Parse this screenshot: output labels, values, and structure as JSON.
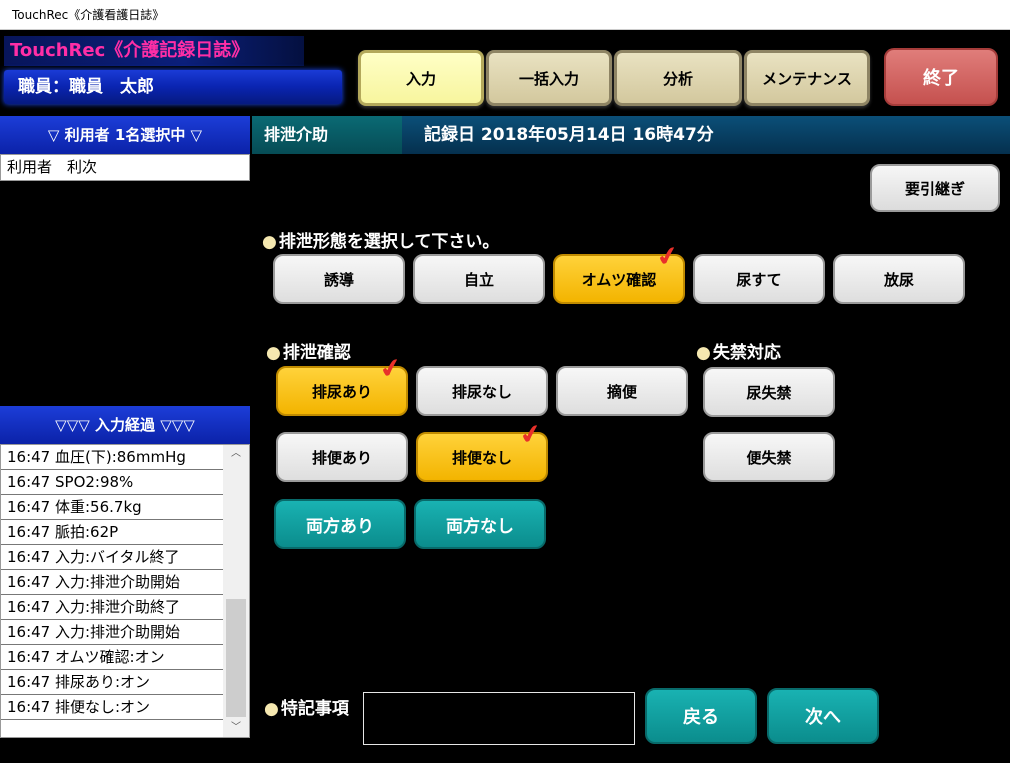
{
  "window": {
    "title": "TouchRec《介護看護日誌》"
  },
  "header": {
    "app_title": "TouchRec《介護記録日誌》",
    "staff": "職員：職員　太郎",
    "nav": [
      "入力",
      "一括入力",
      "分析",
      "メンテナンス"
    ],
    "active_nav": "入力",
    "exit_label": "終了"
  },
  "users_panel": {
    "header": "▽ 利用者 1名選択中 ▽",
    "selected_user": "利用者　利次"
  },
  "section": {
    "name": "排泄介助",
    "record_date": "記録日 2018年05月14日 16時47分"
  },
  "handover_label": "要引継ぎ",
  "excretion_type": {
    "label": "排泄形態を選択して下さい。",
    "options": [
      {
        "label": "誘導",
        "selected": false
      },
      {
        "label": "自立",
        "selected": false
      },
      {
        "label": "オムツ確認",
        "selected": true
      },
      {
        "label": "尿すて",
        "selected": false
      },
      {
        "label": "放尿",
        "selected": false
      }
    ]
  },
  "excretion_check": {
    "label": "排泄確認",
    "options": [
      {
        "label": "排尿あり",
        "selected": true
      },
      {
        "label": "排尿なし",
        "selected": false
      },
      {
        "label": "摘便",
        "selected": false
      },
      {
        "label": "排便あり",
        "selected": false
      },
      {
        "label": "排便なし",
        "selected": true
      }
    ],
    "both_yes": "両方あり",
    "both_no": "両方なし"
  },
  "incontinence": {
    "label": "失禁対応",
    "options": [
      "尿失禁",
      "便失禁"
    ]
  },
  "history": {
    "header": "▽▽▽ 入力経過 ▽▽▽",
    "items": [
      "16:47 血圧(下):86mmHg",
      "16:47 SPO2:98%",
      "16:47 体重:56.7kg",
      "16:47 脈拍:62P",
      "16:47 入力:バイタル終了",
      "16:47 入力:排泄介助開始",
      "16:47 入力:排泄介助終了",
      "16:47 入力:排泄介助開始",
      "16:47 オムツ確認:オン",
      "16:47 排尿あり:オン",
      "16:47 排便なし:オン"
    ]
  },
  "notes": {
    "label": "特記事項",
    "value": ""
  },
  "footer": {
    "back": "戻る",
    "next": "次へ"
  },
  "icons": {
    "check": "red-check-mark-icon",
    "scroll_up": "chevron-up-icon",
    "scroll_down": "chevron-down-icon"
  }
}
